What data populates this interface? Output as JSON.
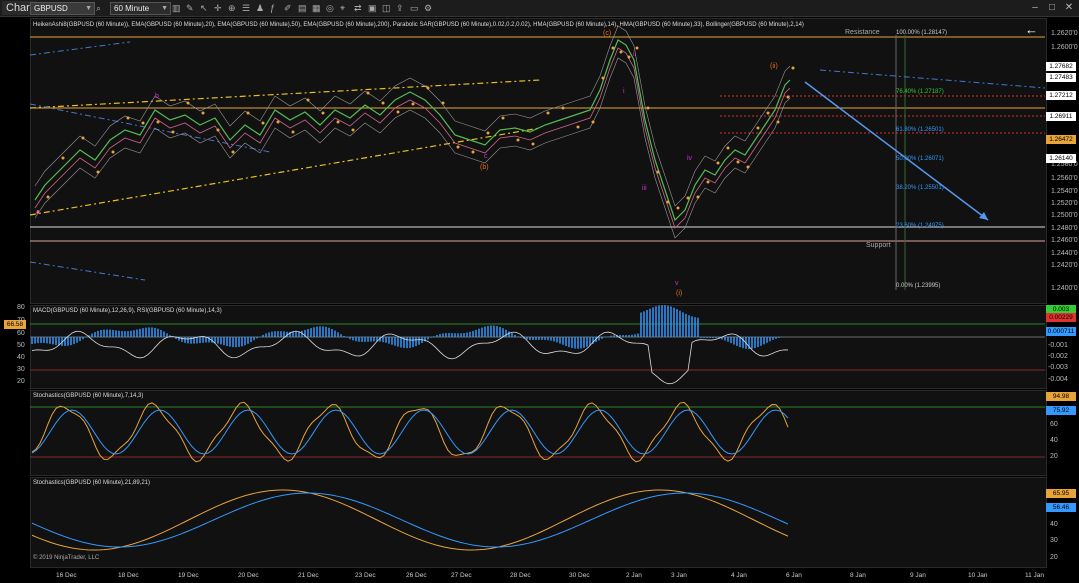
{
  "window": {
    "tab_label": "Chart",
    "instrument": "GBPUSD",
    "period": "60 Minute",
    "toolbar_icons": [
      "search-icon",
      "bar-style-icon",
      "pencil-icon",
      "cursor-icon",
      "crosshair-icon",
      "zoom-icon",
      "properties-icon",
      "strategy-icon",
      "indicator-icon",
      "drawing-icon",
      "template-icon",
      "datebox-icon",
      "global-link-icon",
      "mouse-icon",
      "instrument-link-icon",
      "lock-icon",
      "screenshot-icon",
      "share-icon",
      "attach-icon",
      "settings-icon"
    ],
    "window_buttons": [
      "minimize-icon",
      "maximize-icon",
      "close-icon"
    ],
    "back_arrow": "←"
  },
  "price_panel": {
    "indicator_title": "HeikenAshi8(GBPUSD (60 Minute)), EMA(GBPUSD (60 Minute),20), EMA(GBPUSD (60 Minute),50), EMA(GBPUSD (60 Minute),200), Parabolic SAR(GBPUSD (60 Minute),0.02,0.2,0.02), HMA(GBPUSD (60 Minute),14), HMA(GBPUSD (60 Minute),33), Bollinger(GBPUSD (60 Minute),2,14)",
    "axis_labels": [
      "1.2620'0",
      "1.2600'0",
      "1.2580'0",
      "1.2560'0",
      "1.2540'0",
      "1.2520'0",
      "1.2500'0",
      "1.2480'0",
      "1.2460'0",
      "1.2440'0",
      "1.2420'0",
      "1.2400'0"
    ],
    "price_tags": [
      {
        "text": "1.27682",
        "color": "#ffffff"
      },
      {
        "text": "1.27483",
        "color": "#ffffff"
      },
      {
        "text": "1.27212",
        "color": "#ffffff"
      },
      {
        "text": "1.26911",
        "color": "#ffffff"
      },
      {
        "text": "1.26472",
        "color": "#e8a33a"
      },
      {
        "text": "1.26140",
        "color": "#ffffff"
      }
    ],
    "annotations": {
      "resistance": "Resistance",
      "support": "Support"
    },
    "fib_levels": [
      {
        "text": "100.00% (1.28147)",
        "color": "#cccccc"
      },
      {
        "text": "76.40% (1.27187)",
        "color": "#33cc33"
      },
      {
        "text": "61.80% (1.26501)",
        "color": "#3399ff"
      },
      {
        "text": "50.00% (1.26071)",
        "color": "#3399ff"
      },
      {
        "text": "38.20% (1.25501)",
        "color": "#3399ff"
      },
      {
        "text": "23.60% (1.24975)",
        "color": "#3399ff"
      },
      {
        "text": "0.00% (1.23995)",
        "color": "#cccccc"
      }
    ],
    "wave_labels": [
      {
        "text": "a",
        "color": "#cc33cc"
      },
      {
        "text": "b",
        "color": "#cc33cc"
      },
      {
        "text": "c",
        "color": "#cc33cc"
      },
      {
        "text": "(b)",
        "color": "#e07020"
      },
      {
        "text": "(c)",
        "color": "#e07020"
      },
      {
        "text": "ii",
        "color": "#cc33cc"
      },
      {
        "text": "i",
        "color": "#cc33cc"
      },
      {
        "text": "iii",
        "color": "#cc33cc"
      },
      {
        "text": "iv",
        "color": "#cc33cc"
      },
      {
        "text": "v",
        "color": "#cc33cc"
      },
      {
        "text": "(i)",
        "color": "#e07020"
      },
      {
        "text": "(ii)",
        "color": "#e07020"
      }
    ]
  },
  "macd_panel": {
    "indicator_title": "MACD(GBPUSD (60 Minute),12,26,9), RSI(GBPUSD (60 Minute),14,3)",
    "left_axis": [
      "80",
      "70",
      "60",
      "50",
      "40",
      "30",
      "20"
    ],
    "right_axis": [
      "-0.001",
      "-0.002",
      "-0.003",
      "-0.004"
    ],
    "tags": [
      {
        "text": "0.003",
        "color": "#33cc33"
      },
      {
        "text": "0.00229",
        "color": "#e03030"
      },
      {
        "text": "0.000711",
        "color": "#3399ff"
      }
    ],
    "rsi_tag": "66.58"
  },
  "stoch1_panel": {
    "indicator_title": "Stochastics(GBPUSD (60 Minute),7,14,3)",
    "axis_labels": [
      "60",
      "40",
      "20"
    ],
    "tags": [
      {
        "text": "94.98",
        "color": "#e8a33a"
      },
      {
        "text": "75.92",
        "color": "#3399ff"
      }
    ]
  },
  "stoch2_panel": {
    "indicator_title": "Stochastics(GBPUSD (60 Minute),21,89,21)",
    "axis_labels": [
      "40",
      "30",
      "20"
    ],
    "tags": [
      {
        "text": "65.95",
        "color": "#e8a33a"
      },
      {
        "text": "56.46",
        "color": "#3399ff"
      }
    ],
    "copyright": "© 2019 NinjaTrader, LLC"
  },
  "x_axis": [
    "16 Dec",
    "18 Dec",
    "19 Dec",
    "20 Dec",
    "21 Dec",
    "23 Dec",
    "26 Dec",
    "27 Dec",
    "28 Dec",
    "30 Dec",
    "2 Jan",
    "3 Jan",
    "4 Jan",
    "6 Jan",
    "8 Jan",
    "9 Jan",
    "10 Jan",
    "11 Jan"
  ]
}
